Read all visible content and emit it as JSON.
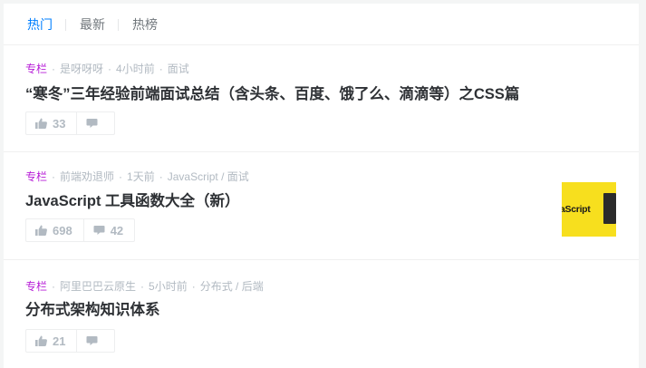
{
  "tabs": [
    "热门",
    "最新",
    "热榜"
  ],
  "entries": [
    {
      "tag": "专栏",
      "author": "是呀呀呀",
      "time": "4小时前",
      "category": "面试",
      "title": "“寒冬”三年经验前端面试总结（含头条、百度、饿了么、滴滴等）之CSS篇",
      "likes": "33",
      "comments": ""
    },
    {
      "tag": "专栏",
      "author": "前端劝退师",
      "time": "1天前",
      "category": "JavaScript / 面试",
      "title": "JavaScript 工具函数大全（新）",
      "likes": "698",
      "comments": "42",
      "thumbnail_text": "aScript"
    },
    {
      "tag": "专栏",
      "author": "阿里巴巴云原生",
      "time": "5小时前",
      "category": "分布式 / 后端",
      "title": "分布式架构知识体系",
      "likes": "21",
      "comments": ""
    }
  ],
  "colors": {
    "accent": "#007fff",
    "tag": "#b71ed7",
    "meta": "#b2bac2",
    "title": "#2e3135",
    "thumbnail_bg": "#f7df1e"
  },
  "icons": {
    "like": "thumbs-up-icon",
    "comment": "comment-icon"
  }
}
